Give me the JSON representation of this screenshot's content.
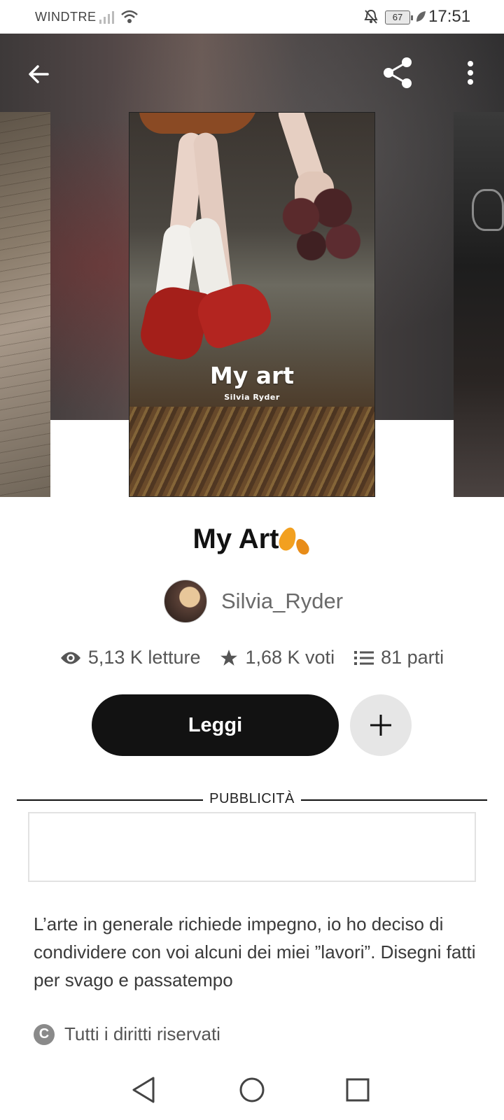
{
  "status_bar": {
    "carrier": "WINDTRE",
    "battery": "67",
    "time": "17:51"
  },
  "header": {
    "back_icon": "arrow-left-icon",
    "share_icon": "share-icon",
    "more_icon": "more-vertical-icon"
  },
  "cover": {
    "title": "My art",
    "author": "Silvia Ryder"
  },
  "story": {
    "title": "My Art",
    "author": "Silvia_Ryder",
    "stats": {
      "reads": "5,13 K letture",
      "votes": "1,68 K voti",
      "parts": "81 parti"
    },
    "read_label": "Leggi",
    "description": "L’arte in generale richiede impegno, io ho deciso di condividere con voi alcuni dei miei ”lavori”. Disegni fatti per svago e passatempo",
    "copyright": "Tutti i diritti riservati"
  },
  "ad": {
    "label": "PUBBLICITÀ"
  },
  "colors": {
    "primary_button": "#121212",
    "secondary_button": "#e6e6e6",
    "accent_leaf": "#f2a020"
  }
}
